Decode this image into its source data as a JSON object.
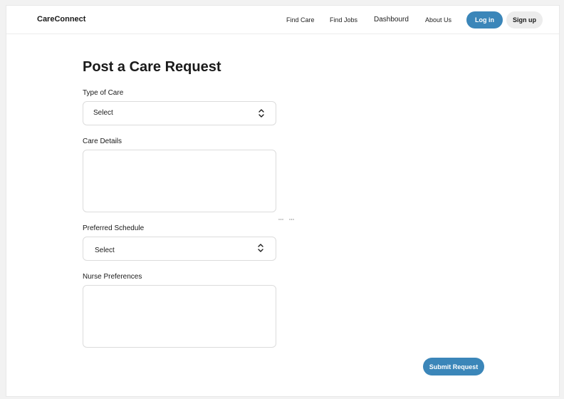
{
  "navbar": {
    "brand": "CareConnect",
    "links": [
      "Find Care",
      "Find Jobs",
      "Dashbourd",
      "About Us"
    ],
    "login_label": "Log in",
    "signup_label": "Sign up"
  },
  "form": {
    "title": "Post a Care Request",
    "type_of_care": {
      "label": "Type of Care",
      "value": "Select",
      "icon": "chevron-up-down-icon"
    },
    "care_details": {
      "label": "Care Details",
      "value": ""
    },
    "preferred_schedule": {
      "label": "Preferred Schedule",
      "value": "Select",
      "icon": "chevron-up-down-icon"
    },
    "nurse_preferences": {
      "label": "Nurse Preferences",
      "value": ""
    },
    "submit_label": "Submit Request"
  },
  "colors": {
    "accent": "#3b86b9",
    "secondary_button": "#ececec"
  }
}
